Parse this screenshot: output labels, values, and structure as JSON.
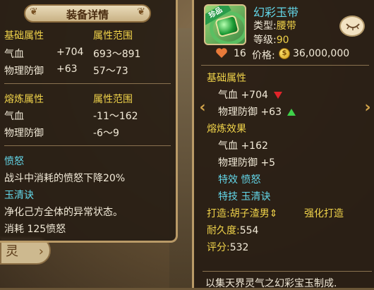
{
  "background": {
    "side_tab_label": "灵"
  },
  "equip_detail": {
    "title": "装备详情",
    "base_header": "基础属性",
    "range_header": "属性范围",
    "base_rows": [
      {
        "name": "气血",
        "value": "+704",
        "range": "693～891"
      },
      {
        "name": "物理防御",
        "value": "+63",
        "range": "57～73"
      }
    ],
    "refine_header": "熔炼属性",
    "refine_range_header": "属性范围",
    "refine_rows": [
      {
        "name": "气血",
        "range": "-11～162"
      },
      {
        "name": "物理防御",
        "range": "-6～9"
      }
    ],
    "special_name": "愤怒",
    "special_desc": "战斗中消耗的愤怒下降20%",
    "skill_name": "玉清诀",
    "skill_desc": "净化己方全体的异常状态。",
    "skill_cost": "消耗 125愤怒"
  },
  "item": {
    "badge": "珍品",
    "name": "幻彩玉带",
    "type_label": "类型:",
    "type_value": "腰带",
    "level_label": "等级:",
    "level_value": "90",
    "likes": "16",
    "price_label": "价格:",
    "price_value": "36,000,000",
    "base_header": "基础属性",
    "base_rows": [
      {
        "text": "气血 +704",
        "trend": "down"
      },
      {
        "text": "物理防御 +63",
        "trend": "up"
      }
    ],
    "refine_header": "熔炼效果",
    "refine_rows": [
      "气血 +162",
      "物理防御 +5"
    ],
    "special_label": "特效",
    "special_value": "愤怒",
    "skill_label": "特技",
    "skill_value": "玉清诀",
    "maker_label": "打造:",
    "maker_value": "胡子渣男",
    "maker_suffix": "⇕",
    "enhance_label": "强化打造",
    "durability_label": "耐久度:",
    "durability_value": "554",
    "score_label": "评分:",
    "score_value": "532",
    "description": "以集天界灵气之幻彩宝玉制成."
  },
  "colors": {
    "header_yellow": "#f0d34a",
    "text_white": "#f2ead8",
    "cyan": "#63d7e9",
    "panel_border": "#b99a67"
  }
}
